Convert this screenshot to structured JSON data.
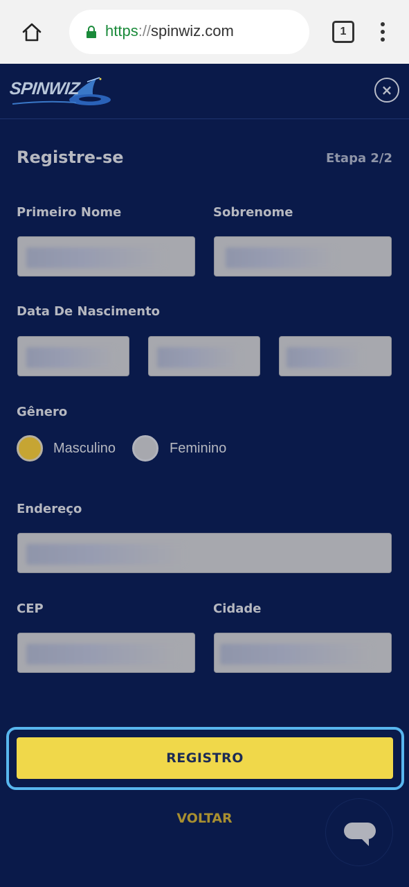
{
  "browser": {
    "url_scheme": "https",
    "url_sep": "://",
    "url_host": "spinwiz.com",
    "tab_count": "1"
  },
  "header": {
    "logo_text": "SPINWIZ",
    "close_glyph": "×"
  },
  "form": {
    "title": "Registre-se",
    "step": "Etapa 2/2",
    "first_name_label": "Primeiro Nome",
    "last_name_label": "Sobrenome",
    "birth_date_label": "Data De Nascimento",
    "gender_label": "Gênero",
    "gender_options": [
      {
        "label": "Masculino",
        "selected": true
      },
      {
        "label": "Feminino",
        "selected": false
      }
    ],
    "address_label": "Endereço",
    "cep_label": "CEP",
    "city_label": "Cidade"
  },
  "actions": {
    "register_label": "REGISTRO",
    "back_label": "VOLTAR"
  },
  "colors": {
    "background": "#0a1a4a",
    "accent_button": "#f0d84a",
    "focus_outline": "#58b6ee",
    "radio_selected": "#c6a533"
  },
  "icons": [
    "home-icon",
    "lock-icon",
    "tabs-icon",
    "more-vert-icon",
    "close-icon",
    "chat-icon",
    "wizard-hat-icon"
  ]
}
